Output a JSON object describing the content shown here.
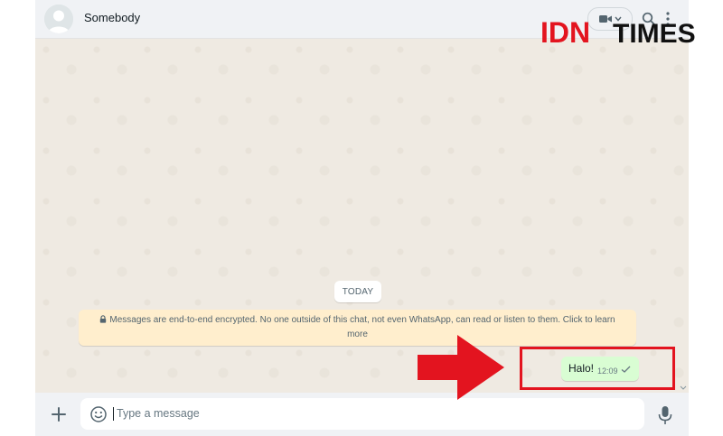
{
  "header": {
    "contact_name": "Somebody",
    "icons": [
      "avatar-placeholder",
      "video-camera-icon",
      "chevron-down-icon",
      "search-icon",
      "menu-icon"
    ]
  },
  "chat": {
    "date_chip": "TODAY",
    "encryption_notice": {
      "line1": "Messages are end-to-end encrypted. No one outside of this chat, not even WhatsApp, can read or listen to them. Click to learn",
      "line2": "more"
    },
    "messages": [
      {
        "direction": "outgoing",
        "text": "Halo!",
        "time": "12:09",
        "status": "sent-single-check"
      }
    ]
  },
  "composer": {
    "placeholder": "Type a message",
    "icons": [
      "plus-icon",
      "emoji-icon",
      "microphone-icon"
    ]
  },
  "watermark": {
    "brand_red": "IDN",
    "brand_black": "TIMES"
  },
  "colors": {
    "chat_background": "#efeae2",
    "header_background": "#f0f2f5",
    "outgoing_bubble": "#d9fdd3",
    "encryption_notice": "#ffeecd",
    "annotation_red": "#e3141f"
  }
}
